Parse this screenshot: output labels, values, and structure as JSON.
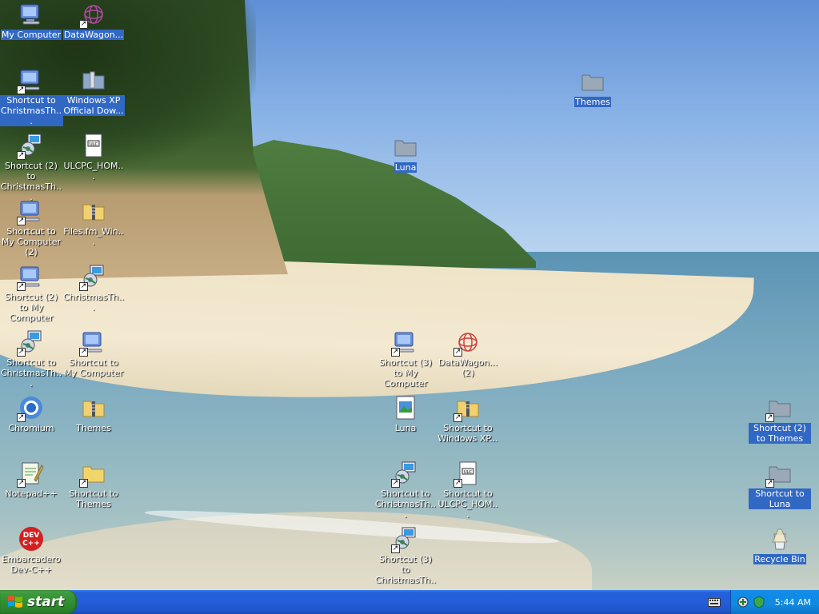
{
  "desktop": {
    "icons": [
      {
        "label": "My Computer",
        "icon": "computer-icon",
        "selected": true
      },
      {
        "label": "DataWagon...",
        "icon": "datawagon-icon",
        "selected": true
      },
      {
        "label": "Shortcut to ChristmasTh...",
        "icon": "computer-icon",
        "selected": true
      },
      {
        "label": "Windows XP Official Dow...",
        "icon": "folder-icon",
        "selected": true
      },
      {
        "label": "Shortcut (2) to ChristmasTh...",
        "icon": "network-computer-icon",
        "selected": false
      },
      {
        "label": "ULCPC_HOM...",
        "icon": "document-icon",
        "selected": false
      },
      {
        "label": "Shortcut to My Computer (2)",
        "icon": "computer-icon",
        "selected": false
      },
      {
        "label": "Files.fm_Win...",
        "icon": "zip-folder-icon",
        "selected": false
      },
      {
        "label": "Shortcut (2) to My Computer",
        "icon": "computer-icon",
        "selected": false
      },
      {
        "label": "ChristmasTh...",
        "icon": "network-computer-icon",
        "selected": false
      },
      {
        "label": "Shortcut to ChristmasTh...",
        "icon": "network-computer-icon",
        "selected": false
      },
      {
        "label": "Shortcut to My Computer",
        "icon": "computer-icon",
        "selected": false
      },
      {
        "label": "Chromium",
        "icon": "chromium-icon",
        "selected": false
      },
      {
        "label": "Themes",
        "icon": "zip-folder-icon",
        "selected": false
      },
      {
        "label": "Notepad++",
        "icon": "notepad-icon",
        "selected": false
      },
      {
        "label": "Shortcut to Themes",
        "icon": "folder-icon",
        "selected": false
      },
      {
        "label": "Embarcadero Dev-C++",
        "icon": "devcpp-icon",
        "selected": false
      },
      {
        "label": "Themes",
        "icon": "folder-icon",
        "selected": true
      },
      {
        "label": "Luna",
        "icon": "folder-icon",
        "selected": true
      },
      {
        "label": "Shortcut (3) to My Computer",
        "icon": "computer-icon",
        "selected": false
      },
      {
        "label": "DataWagon... (2)",
        "icon": "datawagon-icon",
        "selected": false
      },
      {
        "label": "Luna",
        "icon": "image-file-icon",
        "selected": false
      },
      {
        "label": "Shortcut to Windows XP...",
        "icon": "zip-folder-icon",
        "selected": false
      },
      {
        "label": "Shortcut to ChristmasTh...",
        "icon": "network-computer-icon",
        "selected": false
      },
      {
        "label": "Shortcut to ULCPC_HOM...",
        "icon": "document-icon",
        "selected": false
      },
      {
        "label": "Shortcut (3) to ChristmasTh...",
        "icon": "network-computer-icon",
        "selected": false
      },
      {
        "label": "Shortcut (2) to Themes",
        "icon": "folder-icon",
        "selected": true
      },
      {
        "label": "Shortcut to Luna",
        "icon": "folder-icon",
        "selected": true
      },
      {
        "label": "Recycle Bin",
        "icon": "recycle-bin-icon",
        "selected": true
      }
    ]
  },
  "taskbar": {
    "start_label": "start",
    "clock": "5:44 AM"
  },
  "colors": {
    "selection": "#3168c4",
    "taskbar_blue": "#245edb",
    "start_green": "#3c9a3c",
    "tray_blue": "#0e8be8"
  }
}
